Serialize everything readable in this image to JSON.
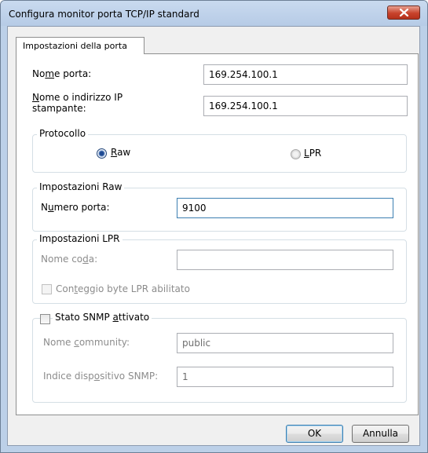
{
  "window": {
    "title": "Configura monitor porta TCP/IP standard"
  },
  "tab": {
    "label": "Impostazioni della porta"
  },
  "port_name": {
    "label_a": "No",
    "label_ul": "m",
    "label_b": "e porta:",
    "value": "169.254.100.1"
  },
  "printer_address": {
    "label_ul": "N",
    "label_a": "ome o indirizzo IP",
    "label_b": "stampante:",
    "value": "169.254.100.1"
  },
  "protocol": {
    "legend": "Protocollo",
    "raw": {
      "ul": "R",
      "rest": "aw",
      "selected": true
    },
    "lpr": {
      "ul": "L",
      "rest": "PR",
      "selected": false
    }
  },
  "raw_settings": {
    "legend": "Impostazioni Raw",
    "port_label_a": "N",
    "port_label_ul": "u",
    "port_label_b": "mero porta:",
    "port_value": "9100"
  },
  "lpr_settings": {
    "legend": "Impostazioni LPR",
    "queue_label_a": "Nome co",
    "queue_label_ul": "d",
    "queue_label_b": "a:",
    "queue_value": "",
    "byte_count_a": "Con",
    "byte_count_ul": "t",
    "byte_count_b": "eggio byte LPR abilitato"
  },
  "snmp": {
    "legend_a": "Stato SNMP ",
    "legend_ul": "a",
    "legend_b": "ttivato",
    "community_label_a": "Nome ",
    "community_label_ul": "c",
    "community_label_b": "ommunity:",
    "community_value": "public",
    "device_label_a": "Indice disp",
    "device_label_ul": "o",
    "device_label_b": "sitivo SNMP:",
    "device_value": "1"
  },
  "buttons": {
    "ok": "OK",
    "cancel": "Annulla"
  }
}
